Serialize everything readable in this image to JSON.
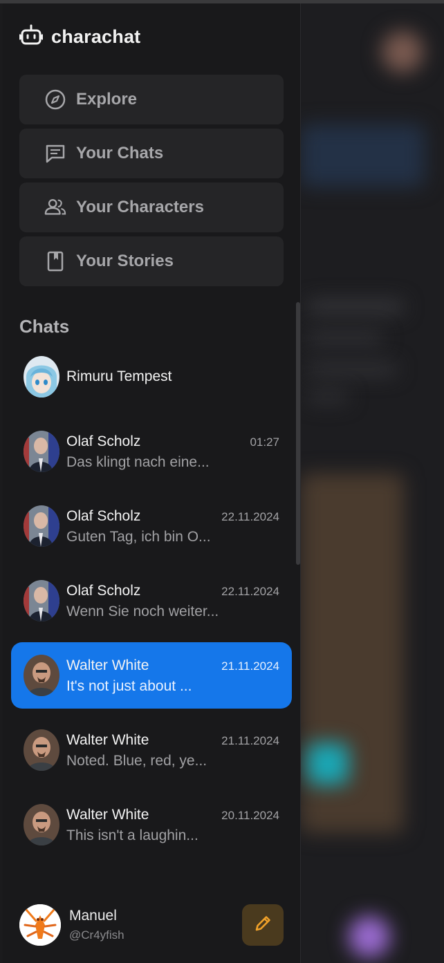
{
  "app": {
    "name": "charachat"
  },
  "nav": [
    {
      "label": "Explore",
      "icon": "compass-icon"
    },
    {
      "label": "Your Chats",
      "icon": "message-icon"
    },
    {
      "label": "Your Characters",
      "icon": "users-icon"
    },
    {
      "label": "Your Stories",
      "icon": "book-icon"
    }
  ],
  "chats_title": "Chats",
  "chats": [
    {
      "name": "Rimuru Tempest",
      "time": "",
      "message": ""
    },
    {
      "name": "Olaf Scholz",
      "time": "01:27",
      "message": "Das klingt nach eine..."
    },
    {
      "name": "Olaf Scholz",
      "time": "22.11.2024",
      "message": "Guten Tag, ich bin O..."
    },
    {
      "name": "Olaf Scholz",
      "time": "22.11.2024",
      "message": "Wenn Sie noch weiter..."
    },
    {
      "name": "Walter White",
      "time": "21.11.2024",
      "message": "It's not just about ..."
    },
    {
      "name": "Walter White",
      "time": "21.11.2024",
      "message": "Noted. Blue, red, ye..."
    },
    {
      "name": "Walter White",
      "time": "20.11.2024",
      "message": "This isn't a laughin..."
    }
  ],
  "active_chat_index": 4,
  "user": {
    "name": "Manuel",
    "handle": "@Cr4yfish"
  },
  "colors": {
    "accent": "#1577ea",
    "edit_button": "#4a3a1e",
    "edit_icon": "#f0a12a"
  }
}
